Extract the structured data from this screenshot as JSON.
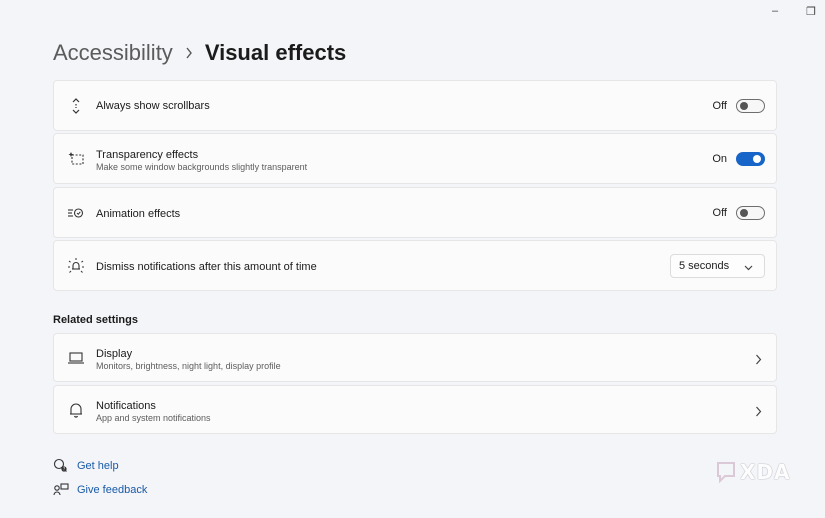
{
  "window": {
    "minimize_glyph": "–",
    "restore_glyph": "❐"
  },
  "breadcrumb": {
    "parent": "Accessibility",
    "current": "Visual effects"
  },
  "settings": [
    {
      "title": "Always show scrollbars",
      "subtitle": "",
      "state": "Off",
      "toggle_on": false,
      "icon": "scrollbar-arrows-icon"
    },
    {
      "title": "Transparency effects",
      "subtitle": "Make some window backgrounds slightly transparent",
      "state": "On",
      "toggle_on": true,
      "icon": "transparency-icon"
    },
    {
      "title": "Animation effects",
      "subtitle": "",
      "state": "Off",
      "toggle_on": false,
      "icon": "animation-icon"
    },
    {
      "title": "Dismiss notifications after this amount of time",
      "subtitle": "",
      "select_value": "5 seconds",
      "icon": "notification-timer-icon"
    }
  ],
  "related": {
    "heading": "Related settings",
    "items": [
      {
        "title": "Display",
        "subtitle": "Monitors, brightness, night light, display profile",
        "icon": "laptop-icon"
      },
      {
        "title": "Notifications",
        "subtitle": "App and system notifications",
        "icon": "bell-icon"
      }
    ]
  },
  "links": {
    "help": "Get help",
    "feedback": "Give feedback"
  },
  "watermark": {
    "text": "XDA"
  },
  "colors": {
    "accent": "#1765c8",
    "link": "#1a5aa6",
    "background": "#f3f5f9",
    "card": "#fbfbfb"
  }
}
